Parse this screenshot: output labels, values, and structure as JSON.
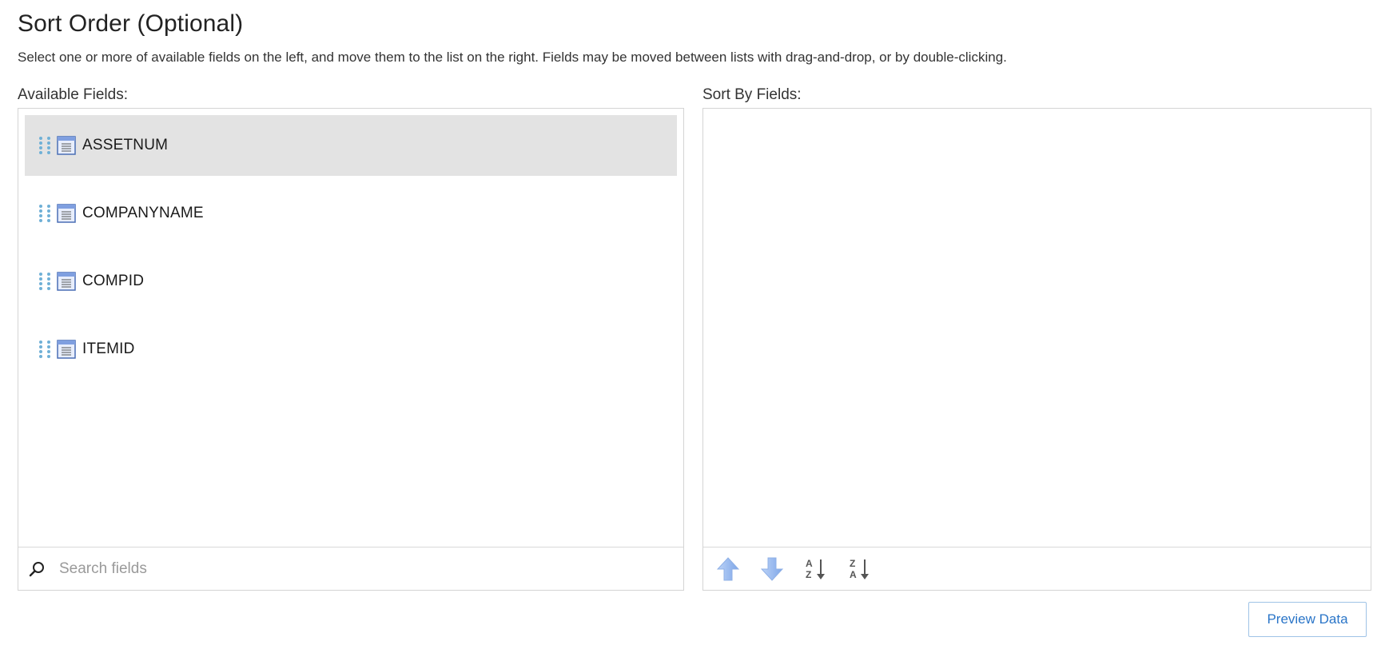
{
  "header": {
    "title": "Sort Order (Optional)",
    "description": "Select one or more of available fields on the left, and move them to the list on the right. Fields may be moved between lists with drag-and-drop, or by double-clicking."
  },
  "available_panel": {
    "label": "Available Fields:",
    "items": [
      {
        "label": "ASSETNUM",
        "selected": true,
        "icon": "table-field-icon"
      },
      {
        "label": "COMPANYNAME",
        "selected": false,
        "icon": "table-field-icon"
      },
      {
        "label": "COMPID",
        "selected": false,
        "icon": "table-field-icon"
      },
      {
        "label": "ITEMID",
        "selected": false,
        "icon": "table-field-icon"
      }
    ],
    "search": {
      "placeholder": "Search fields",
      "value": "",
      "icon": "search-icon"
    }
  },
  "sort_panel": {
    "label": "Sort By Fields:",
    "items": [],
    "tools": [
      {
        "name": "move-up",
        "icon": "arrow-up-icon"
      },
      {
        "name": "move-down",
        "icon": "arrow-down-icon"
      },
      {
        "name": "sort-ascending",
        "icon": "sort-az-icon"
      },
      {
        "name": "sort-descending",
        "icon": "sort-za-icon"
      }
    ]
  },
  "actions": {
    "preview_label": "Preview Data"
  },
  "colors": {
    "accent": "#2a75c8",
    "selected_row": "#e3e3e3",
    "drag_handle": "#6fb0d6"
  }
}
